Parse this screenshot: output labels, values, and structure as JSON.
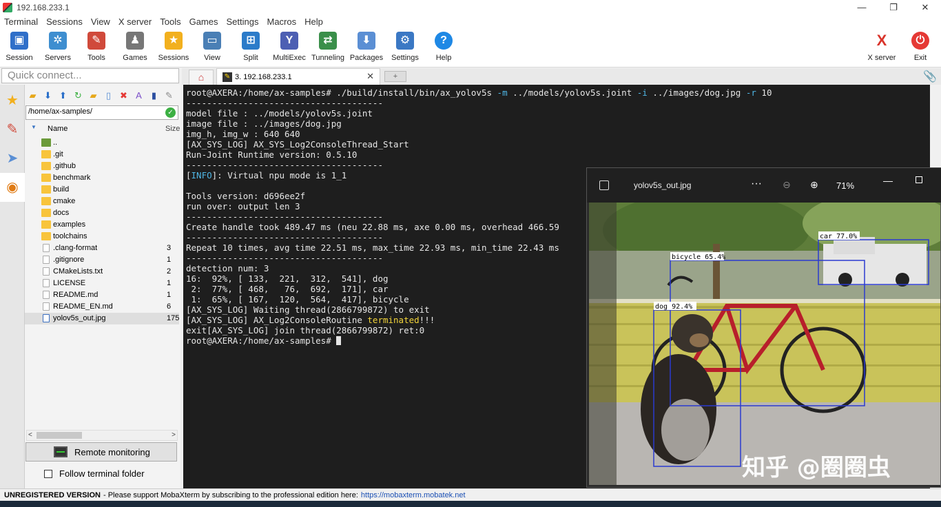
{
  "window": {
    "title": "192.168.233.1",
    "buttons": [
      "—",
      "❐",
      "✕"
    ]
  },
  "menu": [
    "Terminal",
    "Sessions",
    "View",
    "X server",
    "Tools",
    "Games",
    "Settings",
    "Macros",
    "Help"
  ],
  "toolbar": [
    {
      "label": "Session",
      "icon": "session-icon",
      "color": "#2f6fc9"
    },
    {
      "label": "Servers",
      "icon": "servers-icon",
      "color": "#3e8ed0"
    },
    {
      "label": "Tools",
      "icon": "tools-icon",
      "color": "#d04a3b"
    },
    {
      "label": "Games",
      "icon": "games-icon",
      "color": "#777777"
    },
    {
      "label": "Sessions",
      "icon": "star-icon",
      "color": "#f2b01e"
    },
    {
      "label": "View",
      "icon": "view-icon",
      "color": "#4a7fb5"
    },
    {
      "label": "Split",
      "icon": "split-icon",
      "color": "#2b7bc9"
    },
    {
      "label": "MultiExec",
      "icon": "multiexec-icon",
      "color": "#4d5fb3"
    },
    {
      "label": "Tunneling",
      "icon": "tunneling-icon",
      "color": "#3a8f4a"
    },
    {
      "label": "Packages",
      "icon": "packages-icon",
      "color": "#5b8fd4"
    },
    {
      "label": "Settings",
      "icon": "settings-icon",
      "color": "#3b78c4"
    },
    {
      "label": "Help",
      "icon": "help-icon",
      "color": "#1e88e5"
    }
  ],
  "toolbar_right": [
    {
      "label": "X server",
      "icon": "xserver-icon",
      "color": "#d9342b"
    },
    {
      "label": "Exit",
      "icon": "exit-icon",
      "color": "#e53935"
    }
  ],
  "quick_connect": {
    "placeholder": "Quick connect..."
  },
  "session_tab": {
    "label": "3. 192.168.233.1",
    "close": "✕"
  },
  "file_panel": {
    "path": "/home/ax-samples/",
    "columns": {
      "name": "Name",
      "size": "Size"
    },
    "files": [
      {
        "name": "..",
        "size": "",
        "type": "up"
      },
      {
        "name": ".git",
        "size": "",
        "type": "folder"
      },
      {
        "name": ".github",
        "size": "",
        "type": "folder"
      },
      {
        "name": "benchmark",
        "size": "",
        "type": "folder"
      },
      {
        "name": "build",
        "size": "",
        "type": "folder"
      },
      {
        "name": "cmake",
        "size": "",
        "type": "folder"
      },
      {
        "name": "docs",
        "size": "",
        "type": "folder"
      },
      {
        "name": "examples",
        "size": "",
        "type": "folder"
      },
      {
        "name": "toolchains",
        "size": "",
        "type": "folder"
      },
      {
        "name": ".clang-format",
        "size": "3",
        "type": "file"
      },
      {
        "name": ".gitignore",
        "size": "1",
        "type": "file"
      },
      {
        "name": "CMakeLists.txt",
        "size": "2",
        "type": "file"
      },
      {
        "name": "LICENSE",
        "size": "1",
        "type": "file"
      },
      {
        "name": "README.md",
        "size": "1",
        "type": "file"
      },
      {
        "name": "README_EN.md",
        "size": "6",
        "type": "file"
      },
      {
        "name": "yolov5s_out.jpg",
        "size": "175",
        "type": "img"
      }
    ],
    "remote_monitoring": "Remote monitoring",
    "follow_folder": "Follow terminal folder"
  },
  "terminal": {
    "lines": [
      [
        {
          "t": "root@AXERA:/home/ax-samples# ./build/install/bin/ax_yolov5s "
        },
        {
          "t": "-m",
          "c": "cyan"
        },
        {
          "t": " ../models/yolov5s.joint "
        },
        {
          "t": "-i",
          "c": "cyan"
        },
        {
          "t": " ../images/dog.jpg "
        },
        {
          "t": "-r",
          "c": "cyan"
        },
        {
          "t": " 10"
        }
      ],
      [
        {
          "t": "--------------------------------------"
        }
      ],
      [
        {
          "t": "model file : ../models/yolov5s.joint"
        }
      ],
      [
        {
          "t": "image file : ../images/dog.jpg"
        }
      ],
      [
        {
          "t": "img_h, img_w : 640 640"
        }
      ],
      [
        {
          "t": "[AX_SYS_LOG] AX_SYS_Log2ConsoleThread_Start"
        }
      ],
      [
        {
          "t": "Run-Joint Runtime version: 0.5.10"
        }
      ],
      [
        {
          "t": "--------------------------------------"
        }
      ],
      [
        {
          "t": "["
        },
        {
          "t": "INFO",
          "c": "cyan"
        },
        {
          "t": "]: Virtual npu mode is 1_1"
        }
      ],
      [
        {
          "t": ""
        }
      ],
      [
        {
          "t": "Tools version: d696ee2f"
        }
      ],
      [
        {
          "t": "run over: output len 3"
        }
      ],
      [
        {
          "t": "--------------------------------------"
        }
      ],
      [
        {
          "t": "Create handle took 489.47 ms (neu 22.88 ms, axe 0.00 ms, overhead 466.59"
        }
      ],
      [
        {
          "t": "--------------------------------------"
        }
      ],
      [
        {
          "t": "Repeat 10 times, avg time 22.51 ms, max_time 22.93 ms, min_time 22.43 ms"
        }
      ],
      [
        {
          "t": "--------------------------------------"
        }
      ],
      [
        {
          "t": "detection num: 3"
        }
      ],
      [
        {
          "t": "16:  92%, [ 133,  221,  312,  541], dog"
        }
      ],
      [
        {
          "t": " 2:  77%, [ 468,   76,  692,  171], car"
        }
      ],
      [
        {
          "t": " 1:  65%, [ 167,  120,  564,  417], bicycle"
        }
      ],
      [
        {
          "t": "[AX_SYS_LOG] Waiting thread(2866799872) to exit"
        }
      ],
      [
        {
          "t": "[AX_SYS_LOG] AX_Log2ConsoleRoutine "
        },
        {
          "t": "terminated",
          "c": "yellow"
        },
        {
          "t": "!!!"
        }
      ],
      [
        {
          "t": "exit[AX_SYS_LOG] join thread(2866799872) ret:0"
        }
      ],
      [
        {
          "t": "root@AXERA:/home/ax-samples# "
        },
        {
          "t": "",
          "c": "cursor"
        }
      ]
    ]
  },
  "viewer": {
    "title": "yolov5s_out.jpg",
    "zoom": "71%",
    "more": "···",
    "detections": [
      {
        "label": "car 77.0%"
      },
      {
        "label": "bicycle 65.4%"
      },
      {
        "label": "dog 92.4%"
      }
    ],
    "watermark": "知乎 @圈圈虫"
  },
  "status": {
    "bold": "UNREGISTERED VERSION",
    "text": " -  Please support MobaXterm by subscribing to the professional edition here: ",
    "link": "https://mobaxterm.mobatek.net"
  }
}
